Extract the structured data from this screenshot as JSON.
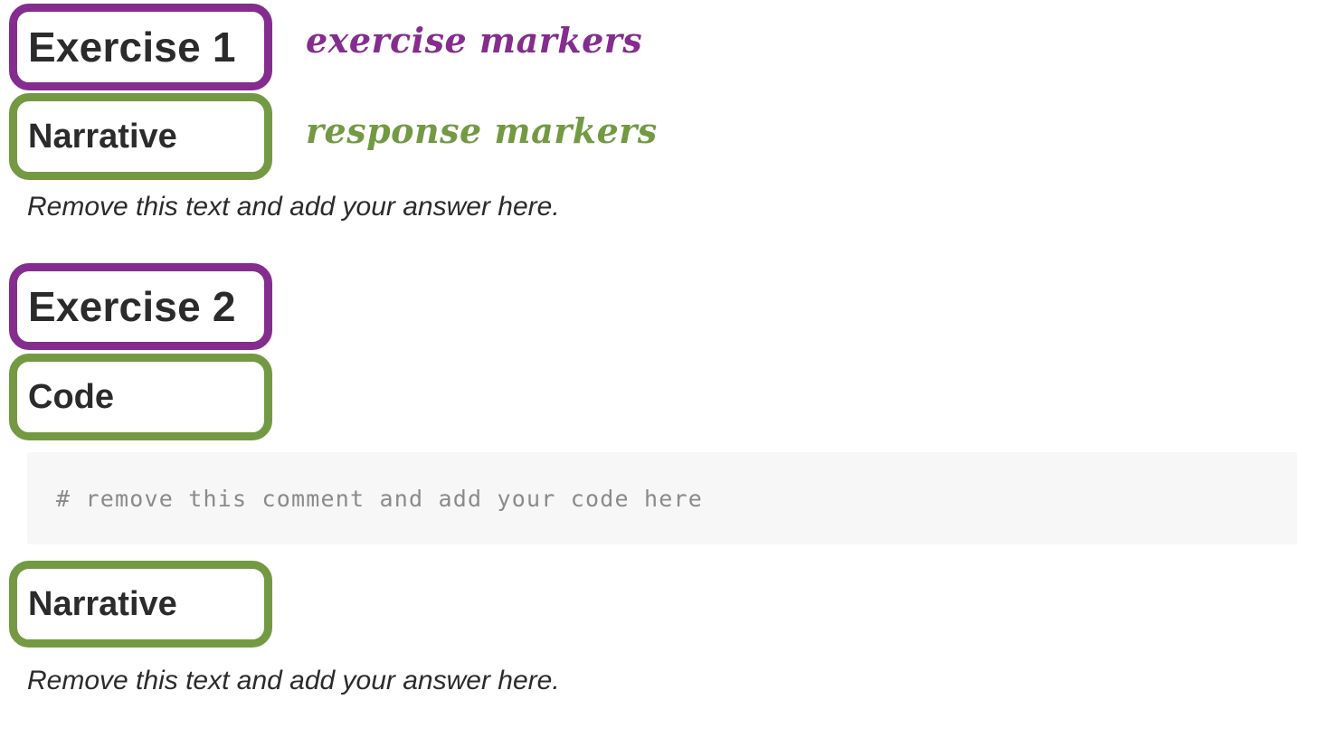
{
  "annotations": {
    "exercise_markers": "exercise markers",
    "response_markers": "response markers"
  },
  "exercise1": {
    "heading": "Exercise 1",
    "response": {
      "label": "Narrative",
      "placeholder_text": "Remove this text and add your answer here."
    }
  },
  "exercise2": {
    "heading": "Exercise 2",
    "code_response": {
      "label": "Code",
      "code_comment": "# remove this comment and add your code here"
    },
    "narrative_response": {
      "label": "Narrative",
      "placeholder_text": "Remove this text and add your answer here."
    }
  },
  "colors": {
    "exercise_marker": "#842d8e",
    "response_marker": "#739a43",
    "code_background": "#f7f7f7"
  }
}
